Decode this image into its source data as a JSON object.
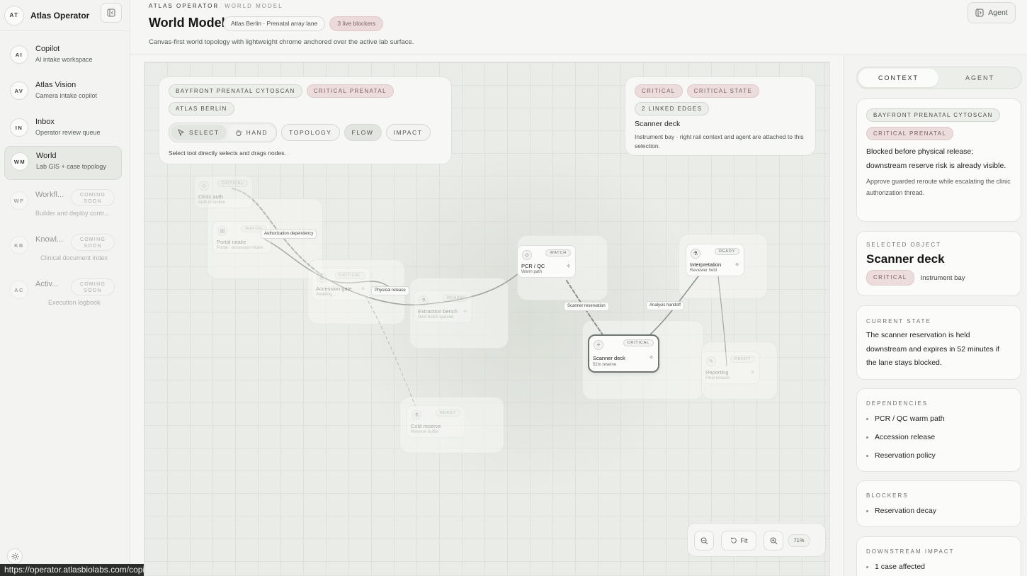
{
  "app": {
    "initials": "AT",
    "name": "Atlas Operator"
  },
  "nav": [
    {
      "initials": "AI",
      "title": "Copilot",
      "sub": "AI intake workspace"
    },
    {
      "initials": "AV",
      "title": "Atlas Vision",
      "sub": "Camera intake copilot"
    },
    {
      "initials": "IN",
      "title": "Inbox",
      "sub": "Operator review queue"
    },
    {
      "initials": "WM",
      "title": "World",
      "sub": "Lab GIS + case topology"
    },
    {
      "initials": "WF",
      "title": "Workfl...",
      "sub": "Builder and deploy contr...",
      "badge": "COMING SOON"
    },
    {
      "initials": "KB",
      "title": "Knowl...",
      "sub": "Clinical document index",
      "badge": "COMING SOON"
    },
    {
      "initials": "AC",
      "title": "Activ...",
      "sub": "Execution logbook",
      "badge": "COMING SOON"
    }
  ],
  "status_url": "https://operator.atlasbiolabs.com/copilot",
  "header": {
    "crumb": "ATLAS OPERATOR",
    "crumb_sub": "WORLD MODEL",
    "title": "World Model",
    "lane": "Atlas Berlin · Prenatal array lane",
    "blockers": "3 live blockers",
    "desc": "Canvas-first world topology with lightweight chrome anchored over the active lab surface.",
    "agent": "Agent"
  },
  "canvas": {
    "case_tags": [
      "BAYFRONT PRENATAL CYTOSCAN",
      "CRITICAL PRENATAL",
      "ATLAS BERLIN"
    ],
    "tools": {
      "select": "SELECT",
      "hand": "HAND",
      "topology": "TOPOLOGY",
      "flow": "FLOW",
      "impact": "IMPACT"
    },
    "tip": "Select tool directly selects and drags nodes.",
    "selection": {
      "tags": [
        "CRITICAL",
        "CRITICAL STATE",
        "2 LINKED EDGES"
      ],
      "title": "Scanner deck",
      "desc": "Instrument bay · right rail context and agent are attached to this selection."
    },
    "nodes": {
      "clinic": {
        "title": "Clinic auth",
        "sub": "Auth in review",
        "status": "CRITICAL"
      },
      "portal": {
        "title": "Portal intake",
        "sub": "Portal · accession intake",
        "status": "WATCH"
      },
      "accession": {
        "title": "Accession gate",
        "sub": "Awaiting...",
        "status": "CRITICAL"
      },
      "extraction": {
        "title": "Extraction bench",
        "sub": "Next batch queued",
        "status": "READY"
      },
      "cold": {
        "title": "Cold reserve",
        "sub": "Reserve buffer",
        "status": "READY"
      },
      "pcr": {
        "title": "PCR / QC",
        "sub": "Warm path",
        "status": "WATCH"
      },
      "scanner": {
        "title": "Scanner deck",
        "sub": "52m reserve",
        "status": "CRITICAL"
      },
      "interp": {
        "title": "Interpretation",
        "sub": "Reviewer held",
        "status": "READY"
      },
      "reporting": {
        "title": "Reporting",
        "sub": "Final release",
        "status": "READY"
      }
    },
    "edges": {
      "auth": "Authorization dependency",
      "physical": "Physical release",
      "scanner": "Scanner reservation",
      "analysis": "Analysis handoff"
    },
    "zoom": {
      "fit": "Fit",
      "level": "71%"
    }
  },
  "rail": {
    "tabs": {
      "context": "CONTEXT",
      "agent": "AGENT"
    },
    "summary": {
      "tags": [
        "BAYFRONT PRENATAL CYTOSCAN",
        "CRITICAL PRENATAL"
      ],
      "body": "Blocked before physical release; downstream reserve risk is already visible.",
      "note": "Approve guarded reroute while escalating the clinic authorization thread."
    },
    "selected": {
      "label": "SELECTED OBJECT",
      "title": "Scanner deck",
      "tag": "CRITICAL",
      "loc": "Instrument bay"
    },
    "state": {
      "label": "CURRENT STATE",
      "body": "The scanner reservation is held downstream and expires in 52 minutes if the lane stays blocked."
    },
    "deps": {
      "label": "DEPENDENCIES",
      "items": [
        "PCR / QC warm path",
        "Accession release",
        "Reservation policy"
      ]
    },
    "blockers": {
      "label": "BLOCKERS",
      "items": [
        "Reservation decay"
      ]
    },
    "impact": {
      "label": "DOWNSTREAM IMPACT",
      "first": "1 case affected"
    }
  }
}
